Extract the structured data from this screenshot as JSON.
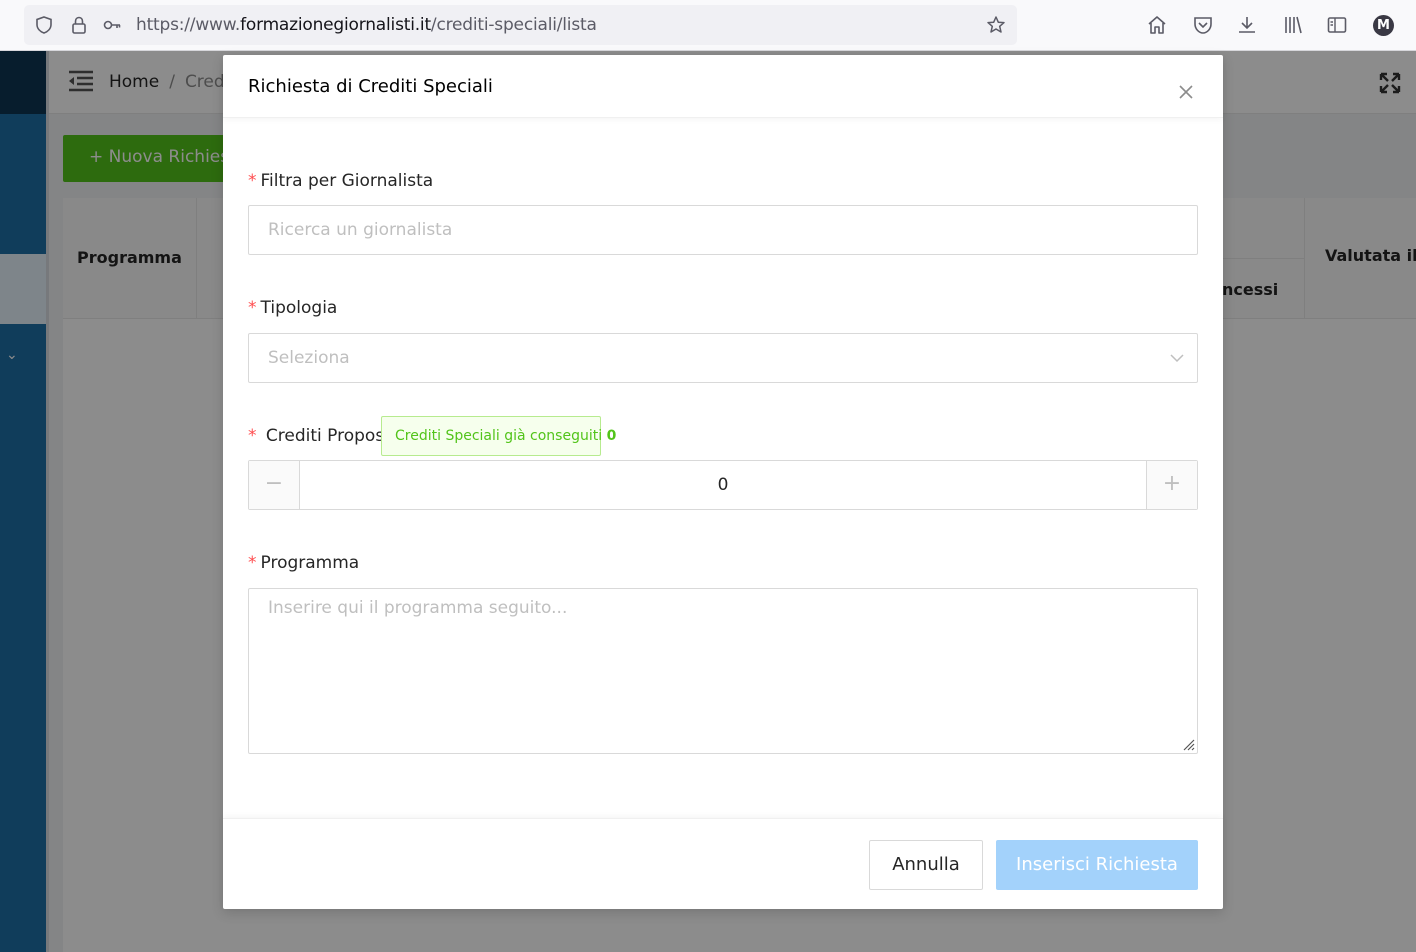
{
  "browser": {
    "url_prefix": "https://www.",
    "url_host": "formazionegiornalisti.it",
    "url_path": "/crediti-speciali/lista",
    "profile_initial": "M"
  },
  "app": {
    "breadcrumb_home": "Home",
    "breadcrumb_sep": "/",
    "breadcrumb_current": "Credi",
    "new_button_label": "Nuova Richies",
    "columns": {
      "programma": "Programma",
      "concessi": "oncessi",
      "valutata": "Valutata il"
    }
  },
  "modal": {
    "title": "Richiesta di Crediti Speciali",
    "required_mark": "*",
    "journalist": {
      "label": "Filtra per Giornalista",
      "placeholder": "Ricerca un giornalista"
    },
    "type": {
      "label": "Tipologia",
      "placeholder": "Seleziona"
    },
    "credits": {
      "label": "Crediti Proposti",
      "tag_text": "Crediti Speciali già conseguiti",
      "tag_value": "0",
      "value": "0",
      "minus": "−",
      "plus": "+"
    },
    "program": {
      "label": "Programma",
      "placeholder": "Inserire qui il programma seguito..."
    },
    "cancel_label": "Annulla",
    "submit_label": "Inserisci Richiesta"
  },
  "colors": {
    "primary_disabled": "#a3d2fb",
    "success": "#52c41a",
    "required": "#ff4d4f",
    "sidebar": "#1e6fa6"
  }
}
